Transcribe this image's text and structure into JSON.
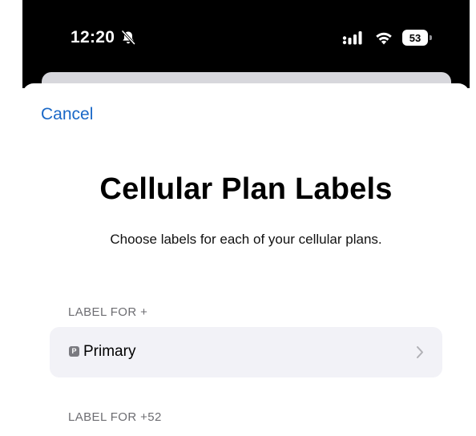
{
  "status_bar": {
    "time": "12:20",
    "battery_level": "53",
    "icons": [
      "bell-slash-icon",
      "signal-icon",
      "wifi-icon",
      "battery-icon"
    ]
  },
  "nav": {
    "cancel_label": "Cancel"
  },
  "header": {
    "title": "Cellular Plan Labels",
    "subtitle": "Choose labels for each of your cellular plans."
  },
  "sections": [
    {
      "header": "LABEL FOR +",
      "row": {
        "badge": "P",
        "label": "Primary",
        "icon": "chevron-right-icon"
      }
    },
    {
      "header": "LABEL FOR +52"
    }
  ],
  "colors": {
    "accent": "#1a68c7",
    "row_background": "#f2f2f7",
    "section_header": "#6d6d72"
  }
}
